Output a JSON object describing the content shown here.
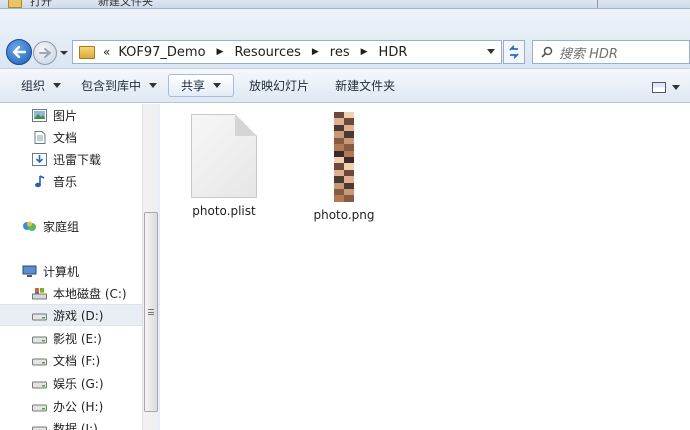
{
  "top_strip": {
    "item1": "打开",
    "item2": "新建文件夹"
  },
  "address_bar": {
    "chevron": "«",
    "crumbs": [
      "KOF97_Demo",
      "Resources",
      "res",
      "HDR"
    ],
    "separator": "▶"
  },
  "search": {
    "placeholder": "搜索 HDR"
  },
  "command_bar": {
    "organize": "组织",
    "include_in_library": "包含到库中",
    "share": "共享",
    "slideshow": "放映幻灯片",
    "new_folder": "新建文件夹"
  },
  "nav_pane": {
    "items": [
      {
        "label": "图片",
        "icon": "pictures-icon"
      },
      {
        "label": "文档",
        "icon": "documents-icon"
      },
      {
        "label": "迅雷下载",
        "icon": "download-icon"
      },
      {
        "label": "音乐",
        "icon": "music-icon"
      },
      {
        "label": "家庭组",
        "icon": "homegroup-icon"
      },
      {
        "label": "计算机",
        "icon": "computer-icon"
      },
      {
        "label": "本地磁盘 (C:)",
        "icon": "system-drive-icon"
      },
      {
        "label": "游戏 (D:)",
        "icon": "drive-icon",
        "selected": true
      },
      {
        "label": "影视 (E:)",
        "icon": "drive-icon"
      },
      {
        "label": "文档 (F:)",
        "icon": "drive-icon"
      },
      {
        "label": "娱乐 (G:)",
        "icon": "drive-icon"
      },
      {
        "label": "办公 (H:)",
        "icon": "drive-icon"
      },
      {
        "label": "数据 (I:)",
        "icon": "drive-icon"
      }
    ]
  },
  "files": [
    {
      "name": "photo.plist",
      "icon": "generic-file-icon"
    },
    {
      "name": "photo.png",
      "icon": "image-strip-icon"
    }
  ],
  "colors": {
    "accent": "#1e5fb6",
    "selection": "#e9eef4"
  }
}
